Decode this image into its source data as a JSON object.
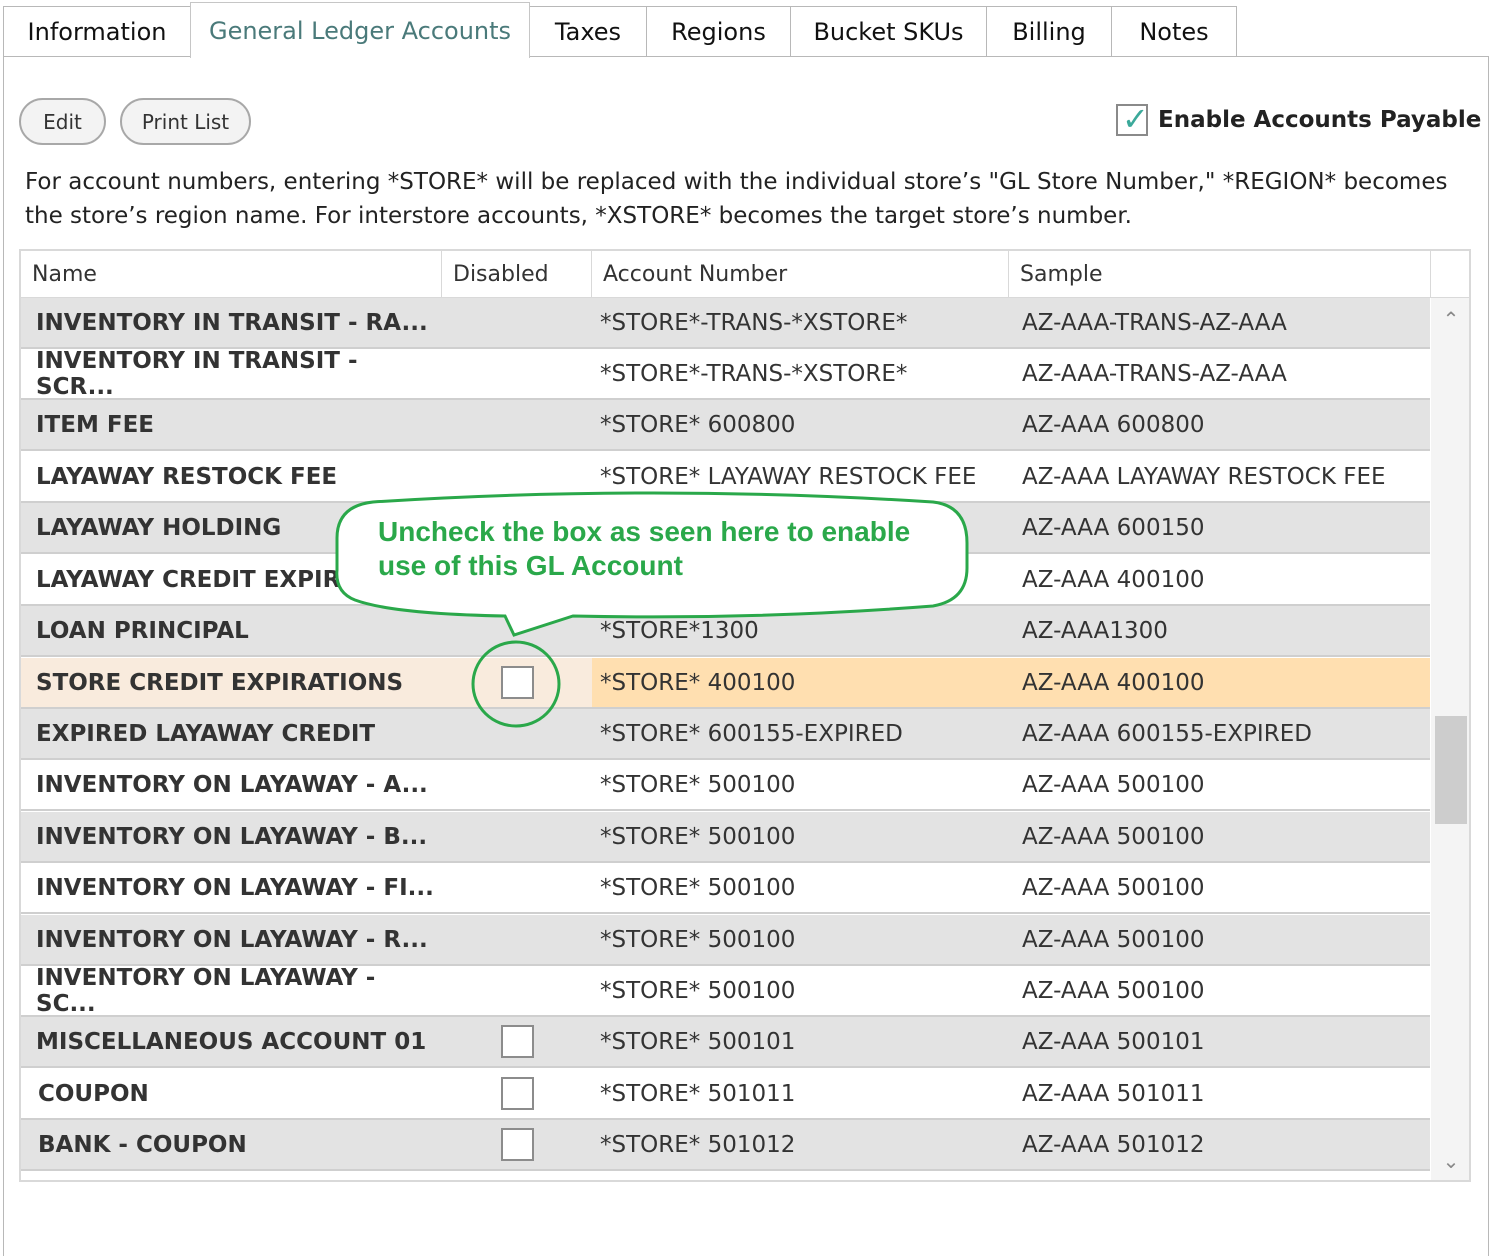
{
  "tabs": [
    {
      "label": "Information"
    },
    {
      "label": "General Ledger Accounts"
    },
    {
      "label": "Taxes"
    },
    {
      "label": "Regions"
    },
    {
      "label": "Bucket SKUs"
    },
    {
      "label": "Billing"
    },
    {
      "label": "Notes"
    }
  ],
  "toolbar": {
    "edit_label": "Edit",
    "print_label": "Print List",
    "enable_ap_label": "Enable Accounts Payable",
    "enable_ap_checked": true
  },
  "help_text": "For account numbers, entering *STORE* will be replaced with the individual store’s \"GL Store Number,\" *REGION* becomes the store’s region name. For interstore accounts, *XSTORE* becomes the target store’s number.",
  "grid": {
    "columns": [
      "Name",
      "Disabled",
      "Account Number",
      "Sample"
    ],
    "rows": [
      {
        "name": "INVENTORY IN TRANSIT - RA...",
        "account": "*STORE*-TRANS-*XSTORE*",
        "sample": "AZ-AAA-TRANS-AZ-AAA"
      },
      {
        "name": "INVENTORY IN TRANSIT - SCR...",
        "account": "*STORE*-TRANS-*XSTORE*",
        "sample": "AZ-AAA-TRANS-AZ-AAA"
      },
      {
        "name": "ITEM FEE",
        "account": "*STORE* 600800",
        "sample": "AZ-AAA 600800"
      },
      {
        "name": "LAYAWAY RESTOCK FEE",
        "account": "*STORE* LAYAWAY RESTOCK FEE",
        "sample": "AZ-AAA LAYAWAY RESTOCK FEE"
      },
      {
        "name": "LAYAWAY HOLDING",
        "account": "",
        "sample": "AZ-AAA 600150"
      },
      {
        "name": "LAYAWAY CREDIT EXPIRA",
        "account": "",
        "sample": "AZ-AAA 400100"
      },
      {
        "name": "LOAN PRINCIPAL",
        "account": "*STORE*1300",
        "sample": "AZ-AAA1300"
      },
      {
        "name": "STORE CREDIT EXPIRATIONS",
        "account": "*STORE* 400100",
        "sample": "AZ-AAA 400100"
      },
      {
        "name": "EXPIRED LAYAWAY CREDIT",
        "account": "*STORE* 600155-EXPIRED",
        "sample": "AZ-AAA 600155-EXPIRED"
      },
      {
        "name": "INVENTORY ON LAYAWAY - A...",
        "account": "*STORE* 500100",
        "sample": "AZ-AAA 500100"
      },
      {
        "name": "INVENTORY ON LAYAWAY - B...",
        "account": "*STORE* 500100",
        "sample": "AZ-AAA 500100"
      },
      {
        "name": "INVENTORY ON LAYAWAY - FI...",
        "account": "*STORE* 500100",
        "sample": "AZ-AAA 500100"
      },
      {
        "name": "INVENTORY ON LAYAWAY - R...",
        "account": "*STORE* 500100",
        "sample": "AZ-AAA 500100"
      },
      {
        "name": "INVENTORY ON LAYAWAY - SC...",
        "account": "*STORE* 500100",
        "sample": "AZ-AAA 500100"
      },
      {
        "name": "MISCELLANEOUS ACCOUNT 01",
        "account": "*STORE* 500101",
        "sample": "AZ-AAA 500101"
      },
      {
        "name": "COUPON",
        "account": "*STORE* 501011",
        "sample": "AZ-AAA 501011"
      },
      {
        "name": "BANK - COUPON",
        "account": "*STORE* 501012",
        "sample": "AZ-AAA 501012"
      }
    ]
  },
  "callout": {
    "text": "Uncheck the box as seen here to enable use of this GL Account",
    "color": "#2aa84a"
  },
  "colors": {
    "active_tab_text": "#4a7a7a",
    "selected_row": "#ffdfb0",
    "check_mark": "#3ba99a"
  }
}
